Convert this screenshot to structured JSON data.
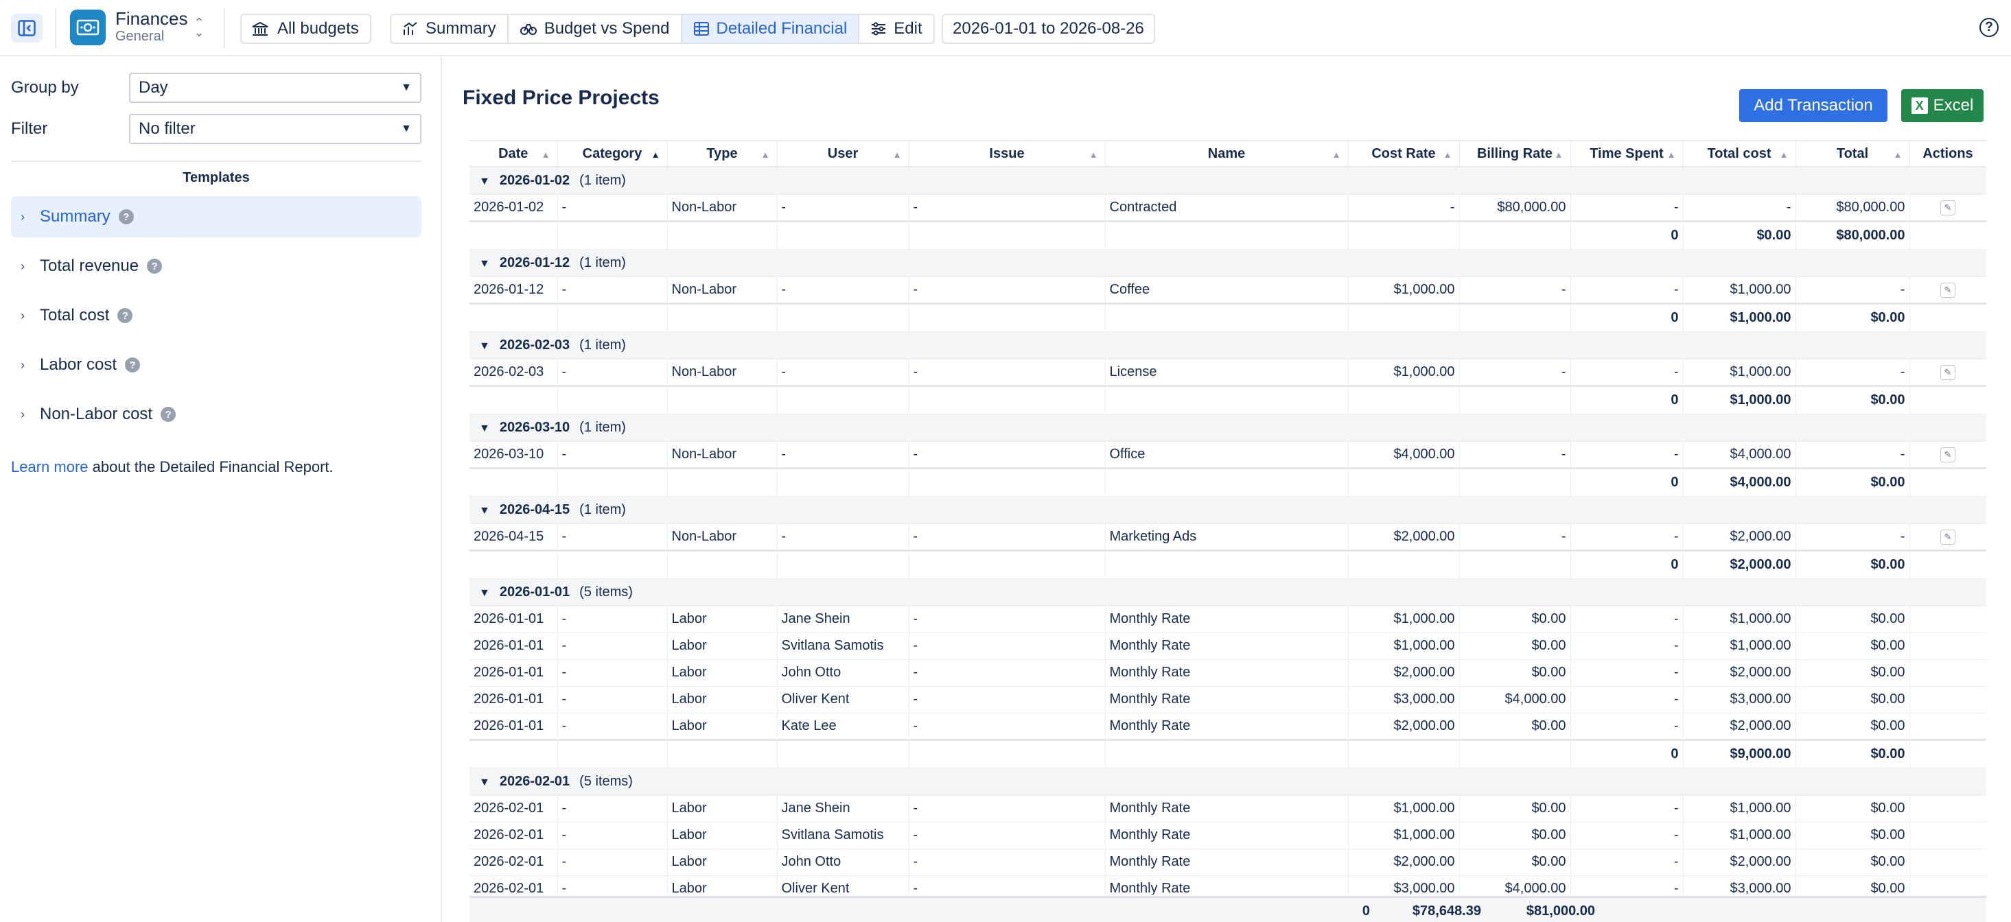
{
  "topbar": {
    "app_title": "Finances",
    "app_subtitle": "General",
    "all_budgets": "All budgets",
    "tabs": [
      {
        "label": "Summary",
        "icon": "chart-up-icon"
      },
      {
        "label": "Budget vs Spend",
        "icon": "scale-icon"
      },
      {
        "label": "Detailed Financial",
        "icon": "table-icon",
        "active": true
      },
      {
        "label": "Edit",
        "icon": "sliders-icon"
      }
    ],
    "date_range": "2026-01-01 to 2026-08-26",
    "help": "?"
  },
  "left": {
    "group_by_label": "Group by",
    "group_by_value": "Day",
    "filter_label": "Filter",
    "filter_value": "No filter",
    "templates_heading": "Templates",
    "templates": [
      {
        "label": "Summary",
        "active": true
      },
      {
        "label": "Total revenue"
      },
      {
        "label": "Total cost"
      },
      {
        "label": "Labor cost"
      },
      {
        "label": "Non-Labor cost"
      }
    ],
    "learn_link": "Learn more",
    "learn_text": " about the Detailed Financial Report."
  },
  "main": {
    "title": "Fixed Price Projects",
    "add_button": "Add Transaction",
    "excel_button": "Excel",
    "columns": [
      "Date",
      "Category",
      "Type",
      "User",
      "Issue",
      "Name",
      "Cost Rate",
      "Billing Rate",
      "Time Spent",
      "Total cost",
      "Total",
      "Actions"
    ],
    "groups": [
      {
        "date": "2026-01-02",
        "count": "(1 item)",
        "rows": [
          [
            "2026-01-02",
            "-",
            "Non-Labor",
            "-",
            "-",
            "Contracted",
            "-",
            "$80,000.00",
            "-",
            "-",
            "$80,000.00"
          ]
        ],
        "subtotal": [
          "0",
          "$0.00",
          "$80,000.00"
        ]
      },
      {
        "date": "2026-01-12",
        "count": "(1 item)",
        "rows": [
          [
            "2026-01-12",
            "-",
            "Non-Labor",
            "-",
            "-",
            "Coffee",
            "$1,000.00",
            "-",
            "-",
            "$1,000.00",
            "-"
          ]
        ],
        "subtotal": [
          "0",
          "$1,000.00",
          "$0.00"
        ]
      },
      {
        "date": "2026-02-03",
        "count": "(1 item)",
        "rows": [
          [
            "2026-02-03",
            "-",
            "Non-Labor",
            "-",
            "-",
            "License",
            "$1,000.00",
            "-",
            "-",
            "$1,000.00",
            "-"
          ]
        ],
        "subtotal": [
          "0",
          "$1,000.00",
          "$0.00"
        ]
      },
      {
        "date": "2026-03-10",
        "count": "(1 item)",
        "rows": [
          [
            "2026-03-10",
            "-",
            "Non-Labor",
            "-",
            "-",
            "Office",
            "$4,000.00",
            "-",
            "-",
            "$4,000.00",
            "-"
          ]
        ],
        "subtotal": [
          "0",
          "$4,000.00",
          "$0.00"
        ]
      },
      {
        "date": "2026-04-15",
        "count": "(1 item)",
        "rows": [
          [
            "2026-04-15",
            "-",
            "Non-Labor",
            "-",
            "-",
            "Marketing Ads",
            "$2,000.00",
            "-",
            "-",
            "$2,000.00",
            "-"
          ]
        ],
        "subtotal": [
          "0",
          "$2,000.00",
          "$0.00"
        ]
      },
      {
        "date": "2026-01-01",
        "count": "(5 items)",
        "rows": [
          [
            "2026-01-01",
            "-",
            "Labor",
            "Jane Shein",
            "-",
            "Monthly Rate",
            "$1,000.00",
            "$0.00",
            "-",
            "$1,000.00",
            "$0.00"
          ],
          [
            "2026-01-01",
            "-",
            "Labor",
            "Svitlana Samotis",
            "-",
            "Monthly Rate",
            "$1,000.00",
            "$0.00",
            "-",
            "$1,000.00",
            "$0.00"
          ],
          [
            "2026-01-01",
            "-",
            "Labor",
            "John Otto",
            "-",
            "Monthly Rate",
            "$2,000.00",
            "$0.00",
            "-",
            "$2,000.00",
            "$0.00"
          ],
          [
            "2026-01-01",
            "-",
            "Labor",
            "Oliver Kent",
            "-",
            "Monthly Rate",
            "$3,000.00",
            "$4,000.00",
            "-",
            "$3,000.00",
            "$0.00"
          ],
          [
            "2026-01-01",
            "-",
            "Labor",
            "Kate Lee",
            "-",
            "Monthly Rate",
            "$2,000.00",
            "$0.00",
            "-",
            "$2,000.00",
            "$0.00"
          ]
        ],
        "subtotal": [
          "0",
          "$9,000.00",
          "$0.00"
        ]
      },
      {
        "date": "2026-02-01",
        "count": "(5 items)",
        "rows": [
          [
            "2026-02-01",
            "-",
            "Labor",
            "Jane Shein",
            "-",
            "Monthly Rate",
            "$1,000.00",
            "$0.00",
            "-",
            "$1,000.00",
            "$0.00"
          ],
          [
            "2026-02-01",
            "-",
            "Labor",
            "Svitlana Samotis",
            "-",
            "Monthly Rate",
            "$1,000.00",
            "$0.00",
            "-",
            "$1,000.00",
            "$0.00"
          ],
          [
            "2026-02-01",
            "-",
            "Labor",
            "John Otto",
            "-",
            "Monthly Rate",
            "$2,000.00",
            "$0.00",
            "-",
            "$2,000.00",
            "$0.00"
          ],
          [
            "2026-02-01",
            "-",
            "Labor",
            "Oliver Kent",
            "-",
            "Monthly Rate",
            "$3,000.00",
            "$4,000.00",
            "-",
            "$3,000.00",
            "$0.00"
          ]
        ],
        "subtotal": null
      }
    ],
    "grand_total": [
      "0",
      "$78,648.39",
      "$81,000.00"
    ]
  },
  "colors": {
    "accent": "#2f6fe4",
    "excel": "#23874a",
    "active_bg": "#e9f0fd",
    "app_icon": "#1e88c7"
  }
}
